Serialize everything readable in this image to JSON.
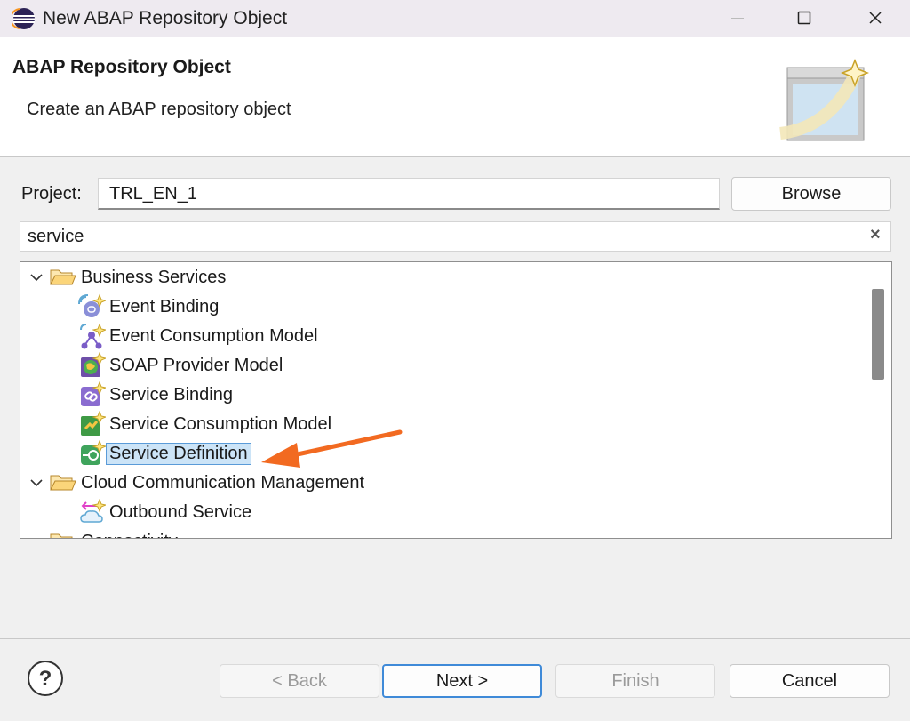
{
  "window": {
    "title": "New ABAP Repository Object",
    "app_icon": "eclipse-icon"
  },
  "header": {
    "title": "ABAP Repository Object",
    "subtitle": "Create an ABAP repository object",
    "banner_icon": "new-object-wizard-icon"
  },
  "project": {
    "label": "Project:",
    "value": "TRL_EN_1",
    "browse_label": "Browse"
  },
  "search": {
    "value": "service",
    "clear_icon": "×"
  },
  "tree": {
    "groups": [
      {
        "label": "Business Services",
        "expanded": true,
        "items": [
          {
            "label": "Event Binding",
            "icon": "event-binding-icon"
          },
          {
            "label": "Event Consumption Model",
            "icon": "event-consumption-model-icon"
          },
          {
            "label": "SOAP Provider Model",
            "icon": "soap-provider-model-icon"
          },
          {
            "label": "Service Binding",
            "icon": "service-binding-icon"
          },
          {
            "label": "Service Consumption Model",
            "icon": "service-consumption-model-icon"
          },
          {
            "label": "Service Definition",
            "icon": "service-definition-icon",
            "selected": true
          }
        ]
      },
      {
        "label": "Cloud Communication Management",
        "expanded": true,
        "items": [
          {
            "label": "Outbound Service",
            "icon": "outbound-service-icon"
          }
        ]
      },
      {
        "label": "Connectivity",
        "expanded": true,
        "items": []
      }
    ]
  },
  "footer": {
    "back_label": "< Back",
    "next_label": "Next >",
    "finish_label": "Finish",
    "cancel_label": "Cancel"
  },
  "colors": {
    "selection_fill": "#cce4f7",
    "selection_border": "#5a9bd8",
    "arrow": "#f26a21",
    "default_button_border": "#3f8ad8"
  }
}
